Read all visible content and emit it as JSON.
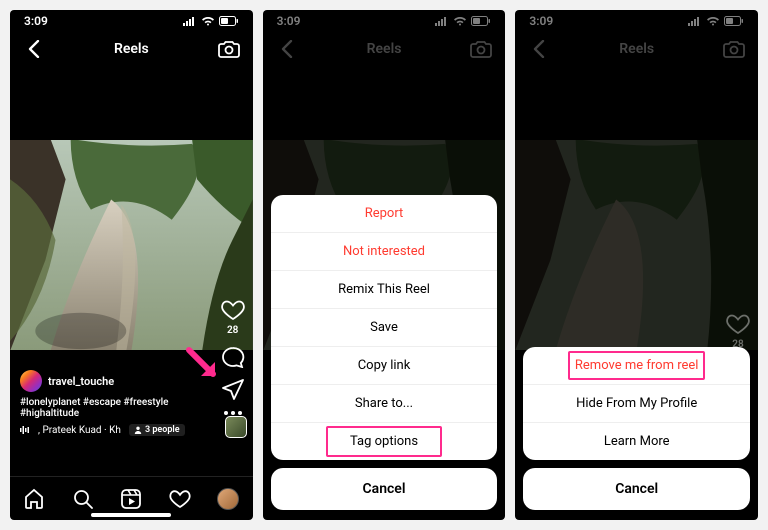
{
  "status": {
    "time": "3:09"
  },
  "header": {
    "title": "Reels"
  },
  "reel": {
    "username": "travel_touche",
    "caption": "#lonelyplanet #escape #freestyle #highaltitude",
    "music_label": ", Prateek Kuad · Kh",
    "people_label": "3 people",
    "like_count": "28"
  },
  "sheet2": {
    "items": [
      {
        "label": "Report",
        "kind": "destructive"
      },
      {
        "label": "Not interested",
        "kind": "destructive"
      },
      {
        "label": "Remix This Reel",
        "kind": "normal"
      },
      {
        "label": "Save",
        "kind": "normal"
      },
      {
        "label": "Copy link",
        "kind": "normal"
      },
      {
        "label": "Share to...",
        "kind": "normal"
      },
      {
        "label": "Tag options",
        "kind": "normal"
      }
    ],
    "cancel": "Cancel"
  },
  "sheet3": {
    "items": [
      {
        "label": "Remove me from reel",
        "kind": "destructive"
      },
      {
        "label": "Hide From My Profile",
        "kind": "normal"
      },
      {
        "label": "Learn More",
        "kind": "normal"
      }
    ],
    "cancel": "Cancel"
  }
}
